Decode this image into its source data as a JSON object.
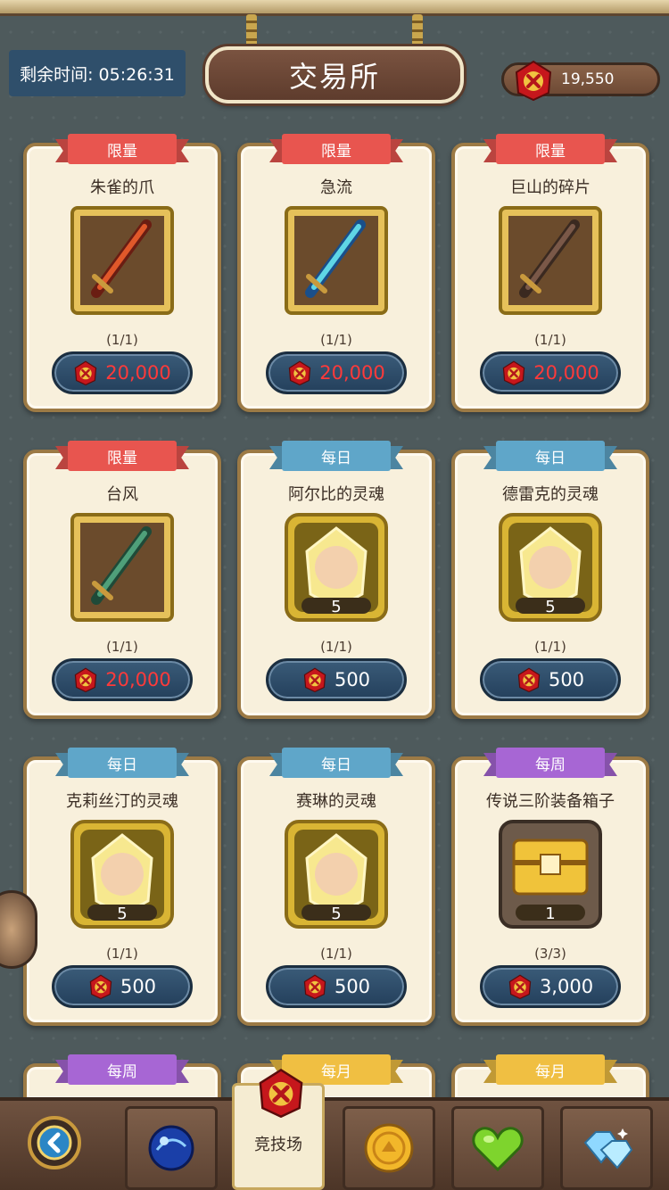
{
  "header": {
    "timer": "剩余时间: 05:26:31",
    "title": "交易所",
    "currency_amount": "19,550"
  },
  "colors": {
    "ribbon_limited": "#e8554f",
    "ribbon_daily": "#5fa6c9",
    "ribbon_weekly": "#a766d4",
    "ribbon_monthly": "#f0bf42",
    "price_red": "#ff3a3a"
  },
  "cards": [
    {
      "ribbon": "限量",
      "name": "朱雀的爪",
      "count": "",
      "limit": "(1/1)",
      "price": "20,000",
      "icon": "flame-sword-icon"
    },
    {
      "ribbon": "限量",
      "name": "急流",
      "count": "",
      "limit": "(1/1)",
      "price": "20,000",
      "icon": "aqua-sword-icon"
    },
    {
      "ribbon": "限量",
      "name": "巨山的碎片",
      "count": "",
      "limit": "(1/1)",
      "price": "20,000",
      "icon": "stone-sword-icon"
    },
    {
      "ribbon": "限量",
      "name": "台风",
      "count": "",
      "limit": "(1/1)",
      "price": "20,000",
      "icon": "wind-sword-icon"
    },
    {
      "ribbon": "每日",
      "name": "阿尔比的灵魂",
      "count": "5",
      "limit": "(1/1)",
      "price": "500",
      "icon": "hero-soul-icon"
    },
    {
      "ribbon": "每日",
      "name": "德雷克的灵魂",
      "count": "5",
      "limit": "(1/1)",
      "price": "500",
      "icon": "hero-soul-icon"
    },
    {
      "ribbon": "每日",
      "name": "克莉丝汀的灵魂",
      "count": "5",
      "limit": "(1/1)",
      "price": "500",
      "icon": "hero-soul-icon"
    },
    {
      "ribbon": "每日",
      "name": "赛琳的灵魂",
      "count": "5",
      "limit": "(1/1)",
      "price": "500",
      "icon": "hero-soul-icon"
    },
    {
      "ribbon": "每周",
      "name": "传说三阶装备箱子",
      "count": "1",
      "limit": "(3/3)",
      "price": "3,000",
      "icon": "treasure-chest-icon"
    }
  ],
  "next_row_ribbons": [
    "每周",
    "每月",
    "每月"
  ],
  "bottom_nav": {
    "active_label": "竞技场"
  }
}
